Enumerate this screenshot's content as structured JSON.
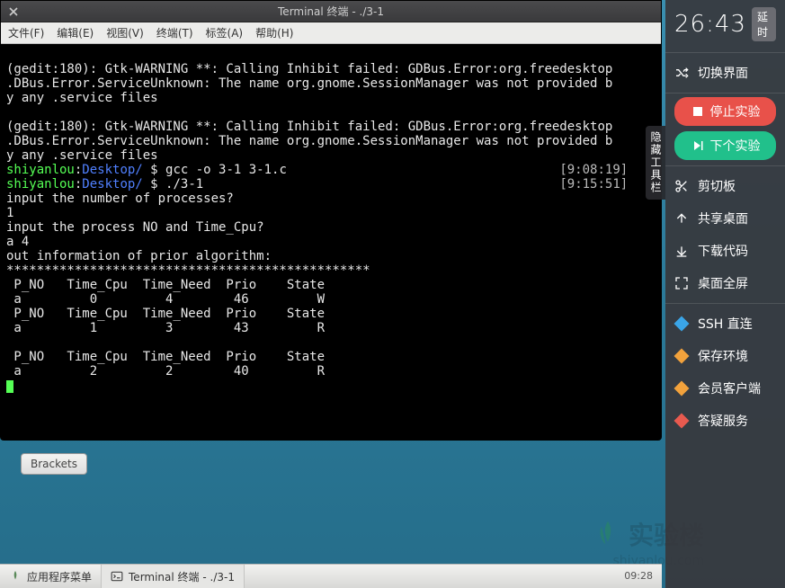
{
  "window": {
    "title": "Terminal 终端 - ./3-1",
    "menus": [
      "文件(F)",
      "编辑(E)",
      "视图(V)",
      "终端(T)",
      "标签(A)",
      "帮助(H)"
    ]
  },
  "terminal": {
    "warn1a": "(gedit:180): Gtk-WARNING **: Calling Inhibit failed: GDBus.Error:org.freedesktop",
    "warn1b": ".DBus.Error.ServiceUnknown: The name org.gnome.SessionManager was not provided b",
    "warn1c": "y any .service files",
    "warn2a": "(gedit:180): Gtk-WARNING **: Calling Inhibit failed: GDBus.Error:org.freedesktop",
    "warn2b": ".DBus.Error.ServiceUnknown: The name org.gnome.SessionManager was not provided b",
    "warn2c": "y any .service files",
    "user": "shiyanlou",
    "path": "Desktop/",
    "cmd1": "gcc -o 3-1 3-1.c",
    "ts1": "[9:08:19]",
    "cmd2": "./3-1",
    "ts2": "[9:15:51]",
    "l1": "input the number of processes?",
    "l2": "1",
    "l3": "input the process NO and Time_Cpu?",
    "l4": "a 4",
    "l5": "out information of prior algorithm:",
    "l6": "************************************************",
    "hdr": " P_NO   Time_Cpu  Time_Need  Prio    State",
    "r1": " a         0         4        46         W",
    "r2": " a         1         3        43         R",
    "r3": " a         2         2        40         R"
  },
  "sidetab": "隐藏工具栏",
  "brackets": "Brackets",
  "sidepanel": {
    "time": "26:43",
    "delay": "延时",
    "switch_ui": "切换界面",
    "stop": "停止实验",
    "next": "下个实验",
    "clipboard": "剪切板",
    "share": "共享桌面",
    "download": "下载代码",
    "fullscreen": "桌面全屏",
    "ssh": "SSH 直连",
    "save_env": "保存环境",
    "client": "会员客户端",
    "qa": "答疑服务"
  },
  "watermark": {
    "main": "实验楼",
    "sub": "shiyanlou.com"
  },
  "taskbar": {
    "apps": "应用程序菜单",
    "task": "Terminal 终端 - ./3-1",
    "clock": "09:28"
  }
}
